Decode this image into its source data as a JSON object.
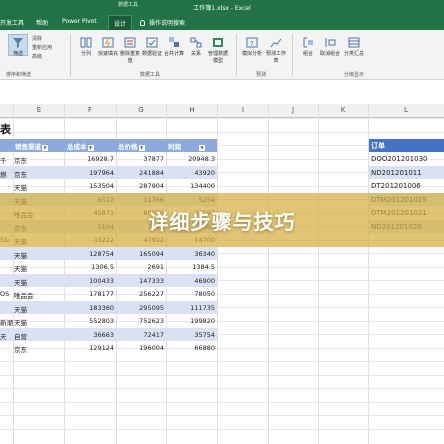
{
  "window": {
    "title": "工作簿1.xlsx  -  Excel",
    "context_tab_group": "数据工具"
  },
  "tabs": [
    {
      "label": "开发工具"
    },
    {
      "label": "帮助"
    },
    {
      "label": "Power Pivot"
    },
    {
      "label": "设计"
    }
  ],
  "tell_me": "操作说明搜索",
  "ribbon": {
    "buttons": [
      {
        "label": "筛选",
        "icon": "filter-icon"
      },
      {
        "label": "分列",
        "icon": "text-to-columns-icon"
      },
      {
        "label": "快速填充",
        "icon": "flash-fill-icon"
      },
      {
        "label": "删除重复值",
        "icon": "remove-duplicates-icon"
      },
      {
        "label": "数据验证",
        "icon": "data-validation-icon"
      },
      {
        "label": "合并计算",
        "icon": "consolidate-icon"
      },
      {
        "label": "关系",
        "icon": "relationships-icon"
      },
      {
        "label": "管理数据模型",
        "icon": "data-model-icon"
      },
      {
        "label": "模拟分析",
        "icon": "what-if-icon"
      },
      {
        "label": "预测工作表",
        "icon": "forecast-sheet-icon"
      },
      {
        "label": "组合",
        "icon": "group-icon"
      },
      {
        "label": "取消组合",
        "icon": "ungroup-icon"
      },
      {
        "label": "分类汇总",
        "icon": "subtotal-icon"
      }
    ],
    "small_items": [
      "清除",
      "重新应用",
      "高级"
    ],
    "groups": [
      "排序和筛选",
      "数据工具",
      "预测",
      "分级显示"
    ]
  },
  "columns": [
    "E",
    "F",
    "G",
    "H",
    "I",
    "J",
    "K",
    "L"
  ],
  "sheet_title": "表",
  "table": {
    "headers": [
      "销售渠道",
      "总成本",
      "总价格",
      "利润"
    ],
    "rows": [
      {
        "a": "千",
        "b": "京东",
        "c": "16928.7",
        "d": "37877",
        "e": "20948.3"
      },
      {
        "a": "燃",
        "b": "京东",
        "c": "197964",
        "d": "241884",
        "e": "43920"
      },
      {
        "a": "",
        "b": "天猫",
        "c": "153504",
        "d": "287904",
        "e": "134400"
      },
      {
        "a": "",
        "b": "天猫",
        "c": "6512",
        "d": "11766",
        "e": "5254"
      },
      {
        "a": "",
        "b": "唯品会",
        "c": "45873",
        "d": "80070",
        "e": "34197"
      },
      {
        "a": "",
        "b": "京东",
        "c": "5104",
        "d": "7200",
        "e": "2096"
      },
      {
        "a": "S&",
        "b": "天猫",
        "c": "33222",
        "d": "47922",
        "e": "14700"
      },
      {
        "a": "",
        "b": "天猫",
        "c": "128754",
        "d": "165094",
        "e": "36340"
      },
      {
        "a": "",
        "b": "天猫",
        "c": "1306.5",
        "d": "2691",
        "e": "1384.5"
      },
      {
        "a": "",
        "b": "天猫",
        "c": "100433",
        "d": "147333",
        "e": "46900"
      },
      {
        "a": "OS",
        "b": "唯品会",
        "c": "178177",
        "d": "256227",
        "e": "78050"
      },
      {
        "a": "",
        "b": "天猫",
        "c": "183360",
        "d": "295095",
        "e": "111735"
      },
      {
        "a": "新潮",
        "b": "天猫",
        "c": "552803",
        "d": "752623",
        "e": "199820"
      },
      {
        "a": "天",
        "b": "自营",
        "c": "36663",
        "d": "72417",
        "e": "35754"
      },
      {
        "a": "",
        "b": "京东",
        "c": "129124",
        "d": "196004",
        "e": "66880"
      }
    ]
  },
  "orders": {
    "header": "订单",
    "items": [
      "DOO201201030",
      "ND201201011",
      "DT201201006",
      "DTM201201025",
      "DTM201201021",
      "ND201201020"
    ]
  },
  "banner": {
    "text": "详细步骤与技巧",
    "color": "#d6ae40"
  },
  "colors": {
    "excel_green": "#217346",
    "table_header": "#8ea9db",
    "stripe": "#d9e1f2",
    "order_header": "#4472c4"
  }
}
